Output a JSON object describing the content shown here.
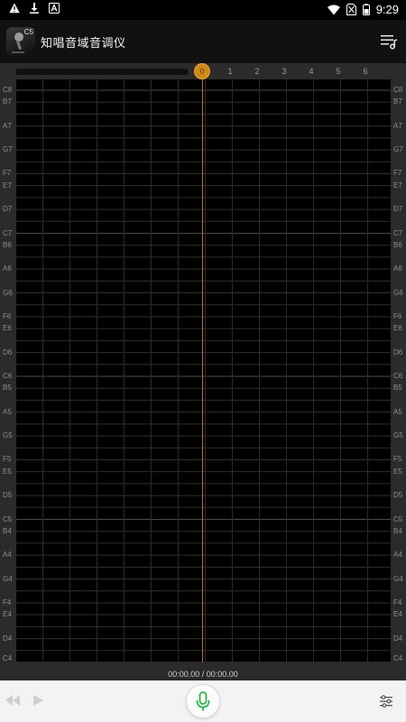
{
  "status_bar": {
    "time": "9:29",
    "left_icons": [
      "warning-icon",
      "download-icon",
      "app-notification-icon"
    ],
    "right_icons": [
      "wifi-icon",
      "no-sim-icon",
      "battery-icon"
    ]
  },
  "header": {
    "app_icon_text": "C5",
    "title": "知唱音域音调仪",
    "menu_icon": "music-list-icon"
  },
  "timeline": {
    "playhead_label": "0",
    "ticks": [
      "1",
      "2",
      "3",
      "4",
      "5",
      "6"
    ],
    "playhead_color": "#d08a1a"
  },
  "notes": [
    "C8",
    "B7",
    "A7",
    "G7",
    "F7",
    "E7",
    "D7",
    "C7",
    "B6",
    "A6",
    "G6",
    "F6",
    "E6",
    "D6",
    "C6",
    "B5",
    "A5",
    "G5",
    "F5",
    "E5",
    "D5",
    "C5",
    "B4",
    "A4",
    "G4",
    "F4",
    "E4",
    "D4",
    "C4"
  ],
  "time_display": "00:00.00 / 00:00.00",
  "toolbar": {
    "rewind_icon": "rewind-icon",
    "play_icon": "play-icon",
    "mic_icon": "microphone-icon",
    "settings_icon": "sliders-icon",
    "accent": "#2bb94a"
  }
}
